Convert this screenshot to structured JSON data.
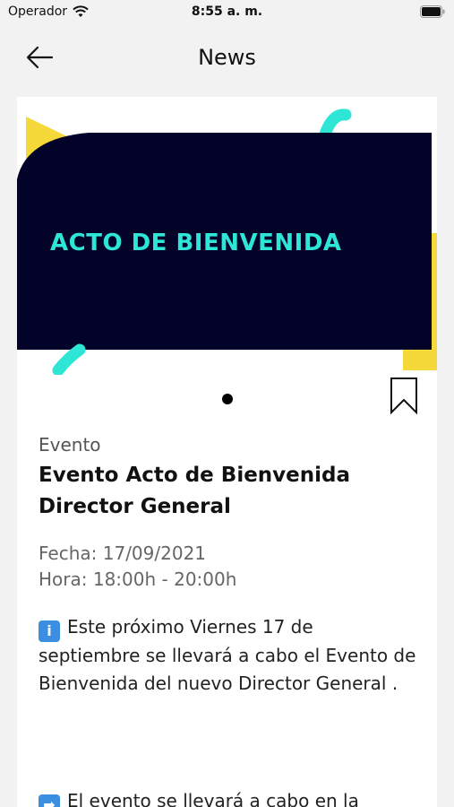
{
  "status_bar": {
    "carrier": "Operador",
    "time": "8:55 a. m."
  },
  "header": {
    "title": "News",
    "back_icon": "arrow-left-icon"
  },
  "banner": {
    "title": "ACTO DE BIENVENIDA",
    "colors": {
      "navy": "#03032a",
      "accent_cyan": "#2ee6d6",
      "accent_yellow": "#f5d83a"
    }
  },
  "article": {
    "category": "Evento",
    "title": "Evento Acto de Bienvenida Director General",
    "date": "Fecha: 17/09/2021",
    "time": "Hora: 18:00h - 20:00h",
    "paragraphs": [
      {
        "icon": "information-emoji",
        "icon_glyph": "i",
        "text": "Este próximo Viernes 17 de septiembre se llevará a cabo el Evento de Bienvenida del nuevo Director General ."
      },
      {
        "icon": "right-arrow-emoji",
        "icon_glyph": "➡",
        "text": "El evento se llevará a cabo en la"
      }
    ]
  }
}
